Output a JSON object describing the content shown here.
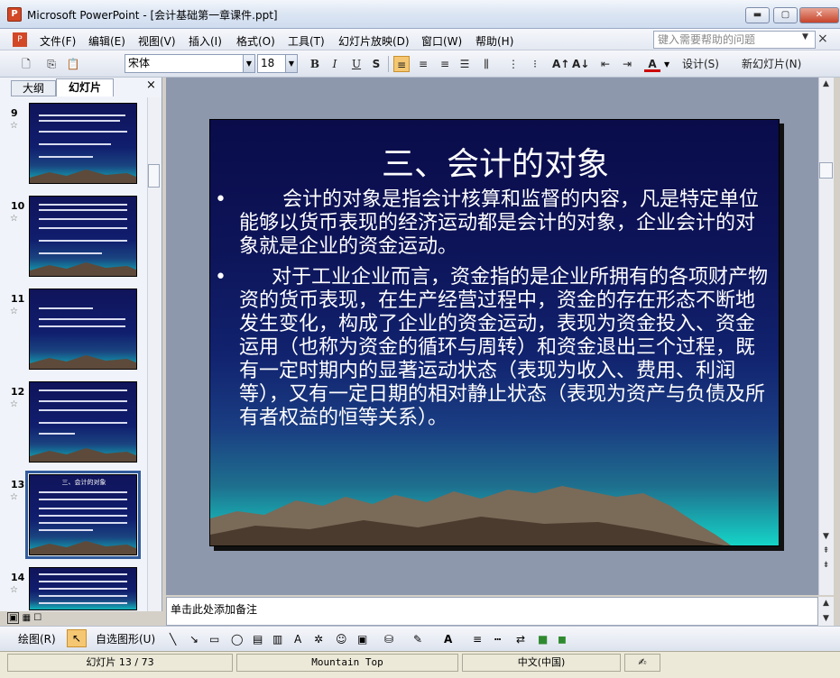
{
  "window": {
    "app_icon_text": "P",
    "title": "Microsoft PowerPoint - [会计基础第一章课件.ppt]",
    "min": "▬",
    "max": "▢",
    "close": "✕"
  },
  "menu": {
    "items": [
      "文件(F)",
      "编辑(E)",
      "视图(V)",
      "插入(I)",
      "格式(O)",
      "工具(T)",
      "幻灯片放映(D)",
      "窗口(W)",
      "帮助(H)"
    ],
    "help_placeholder": "键入需要帮助的问题",
    "close": "×"
  },
  "toolbar": {
    "font": "宋体",
    "size": "18",
    "bold": "B",
    "italic": "I",
    "underline": "U",
    "shadow": "S",
    "design": "设计(S)",
    "new_slide": "新幻灯片(N)",
    "font_color_glyph": "A"
  },
  "panel": {
    "tabs": [
      "大纲",
      "幻灯片"
    ],
    "close": "×",
    "thumb_numbers": [
      "9",
      "10",
      "11",
      "12",
      "13",
      "14"
    ],
    "thumb13_title": "三、会计的对象"
  },
  "slide": {
    "title": "三、会计的对象",
    "bullet": "•",
    "paragraphs": [
      "会计的对象是指会计核算和监督的内容，凡是特定单位能够以货币表现的经济运动都是会计的对象，企业会计的对象就是企业的资金运动。",
      "对于工业企业而言，资金指的是企业所拥有的各项财产物资的货币表现，在生产经营过程中，资金的存在形态不断地发生变化，构成了企业的资金运动，表现为资金投入、资金运用（也称为资金的循环与周转）和资金退出三个过程，既有一定时期内的显著运动状态（表现为收入、费用、利润等），又有一定日期的相对静止状态（表现为资产与负债及所有者权益的恒等关系）。"
    ]
  },
  "notes": {
    "placeholder": "单击此处添加备注"
  },
  "drawbar": {
    "draw": "绘图(R)",
    "autoshapes": "自选图形(U)"
  },
  "status": {
    "slide": "幻灯片 13 / 73",
    "design": "Mountain Top",
    "language": "中文(中国)"
  }
}
